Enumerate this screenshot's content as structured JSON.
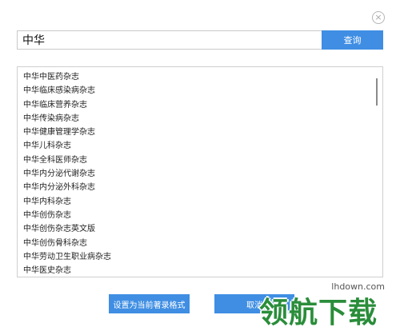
{
  "dialog": {
    "close_glyph": "×"
  },
  "search": {
    "value": "中华",
    "button_label": "查询"
  },
  "results": {
    "items": [
      "中华中医药杂志",
      "中华临床感染病杂志",
      "中华临床营养杂志",
      "中华传染病杂志",
      "中华健康管理学杂志",
      "中华儿科杂志",
      "中华全科医师杂志",
      "中华内分泌代谢杂志",
      "中华内分泌外科杂志",
      "中华内科杂志",
      "中华创伤杂志",
      "中华创伤杂志英文版",
      "中华创伤骨科杂志",
      "中华劳动卫生职业病杂志",
      "中华医史杂志"
    ]
  },
  "footer": {
    "set_format_label": "设置为当前著录格式",
    "cancel_label": "取消"
  },
  "watermark": {
    "url": "lhdown.com",
    "text": "领航下载"
  },
  "colors": {
    "accent": "#3f8ee3",
    "watermark_green": "#2a8d3a"
  }
}
